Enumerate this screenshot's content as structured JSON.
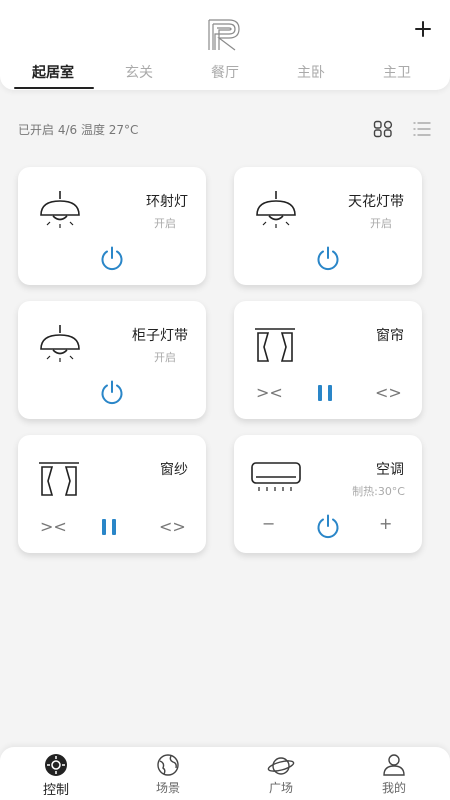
{
  "header": {
    "tabs": [
      "起居室",
      "玄关",
      "餐厅",
      "主卧",
      "主卫"
    ],
    "active_tab": "起居室"
  },
  "status": {
    "text": "已开启 4/6  温度 27°C"
  },
  "devices": [
    {
      "name": "环射灯",
      "state": "开启",
      "icon": "ceiling-lamp-icon"
    },
    {
      "name": "天花灯带",
      "state": "开启",
      "icon": "ceiling-lamp-icon"
    },
    {
      "name": "柜子灯带",
      "state": "开启",
      "icon": "ceiling-lamp-icon"
    },
    {
      "name": "窗帘",
      "icon": "curtain-icon",
      "controls": [
        "><",
        "<>"
      ]
    },
    {
      "name": "窗纱",
      "icon": "curtain-icon",
      "controls": [
        "><",
        "<>"
      ]
    },
    {
      "name": "空调",
      "state": "制热:30°C",
      "icon": "air-conditioner-icon",
      "controls": [
        "−",
        "+"
      ]
    }
  ],
  "colors": {
    "accent": "#2a86c8",
    "background": "#f4f4f4"
  },
  "bottom_nav": [
    {
      "label": "控制",
      "icon": "control-icon",
      "active": true
    },
    {
      "label": "场景",
      "icon": "scene-icon"
    },
    {
      "label": "广场",
      "icon": "plaza-icon"
    },
    {
      "label": "我的",
      "icon": "profile-icon"
    }
  ]
}
